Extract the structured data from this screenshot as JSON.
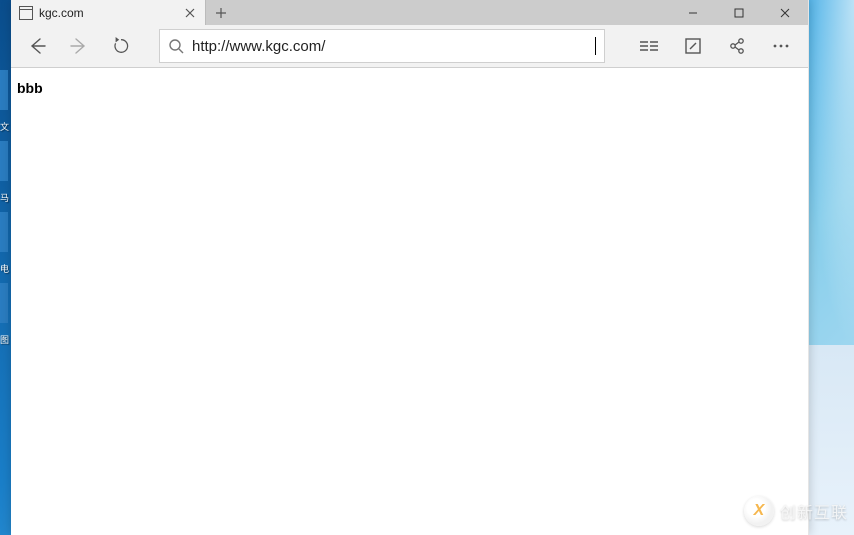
{
  "tab": {
    "title": "kgc.com"
  },
  "toolbar": {
    "address": "http://www.kgc.com/"
  },
  "page": {
    "content": "bbb"
  },
  "watermark": {
    "logo_glyph": "X",
    "text": "创新互联"
  },
  "desktop": {
    "partial_labels": [
      "文",
      "马",
      "电",
      "图"
    ]
  }
}
